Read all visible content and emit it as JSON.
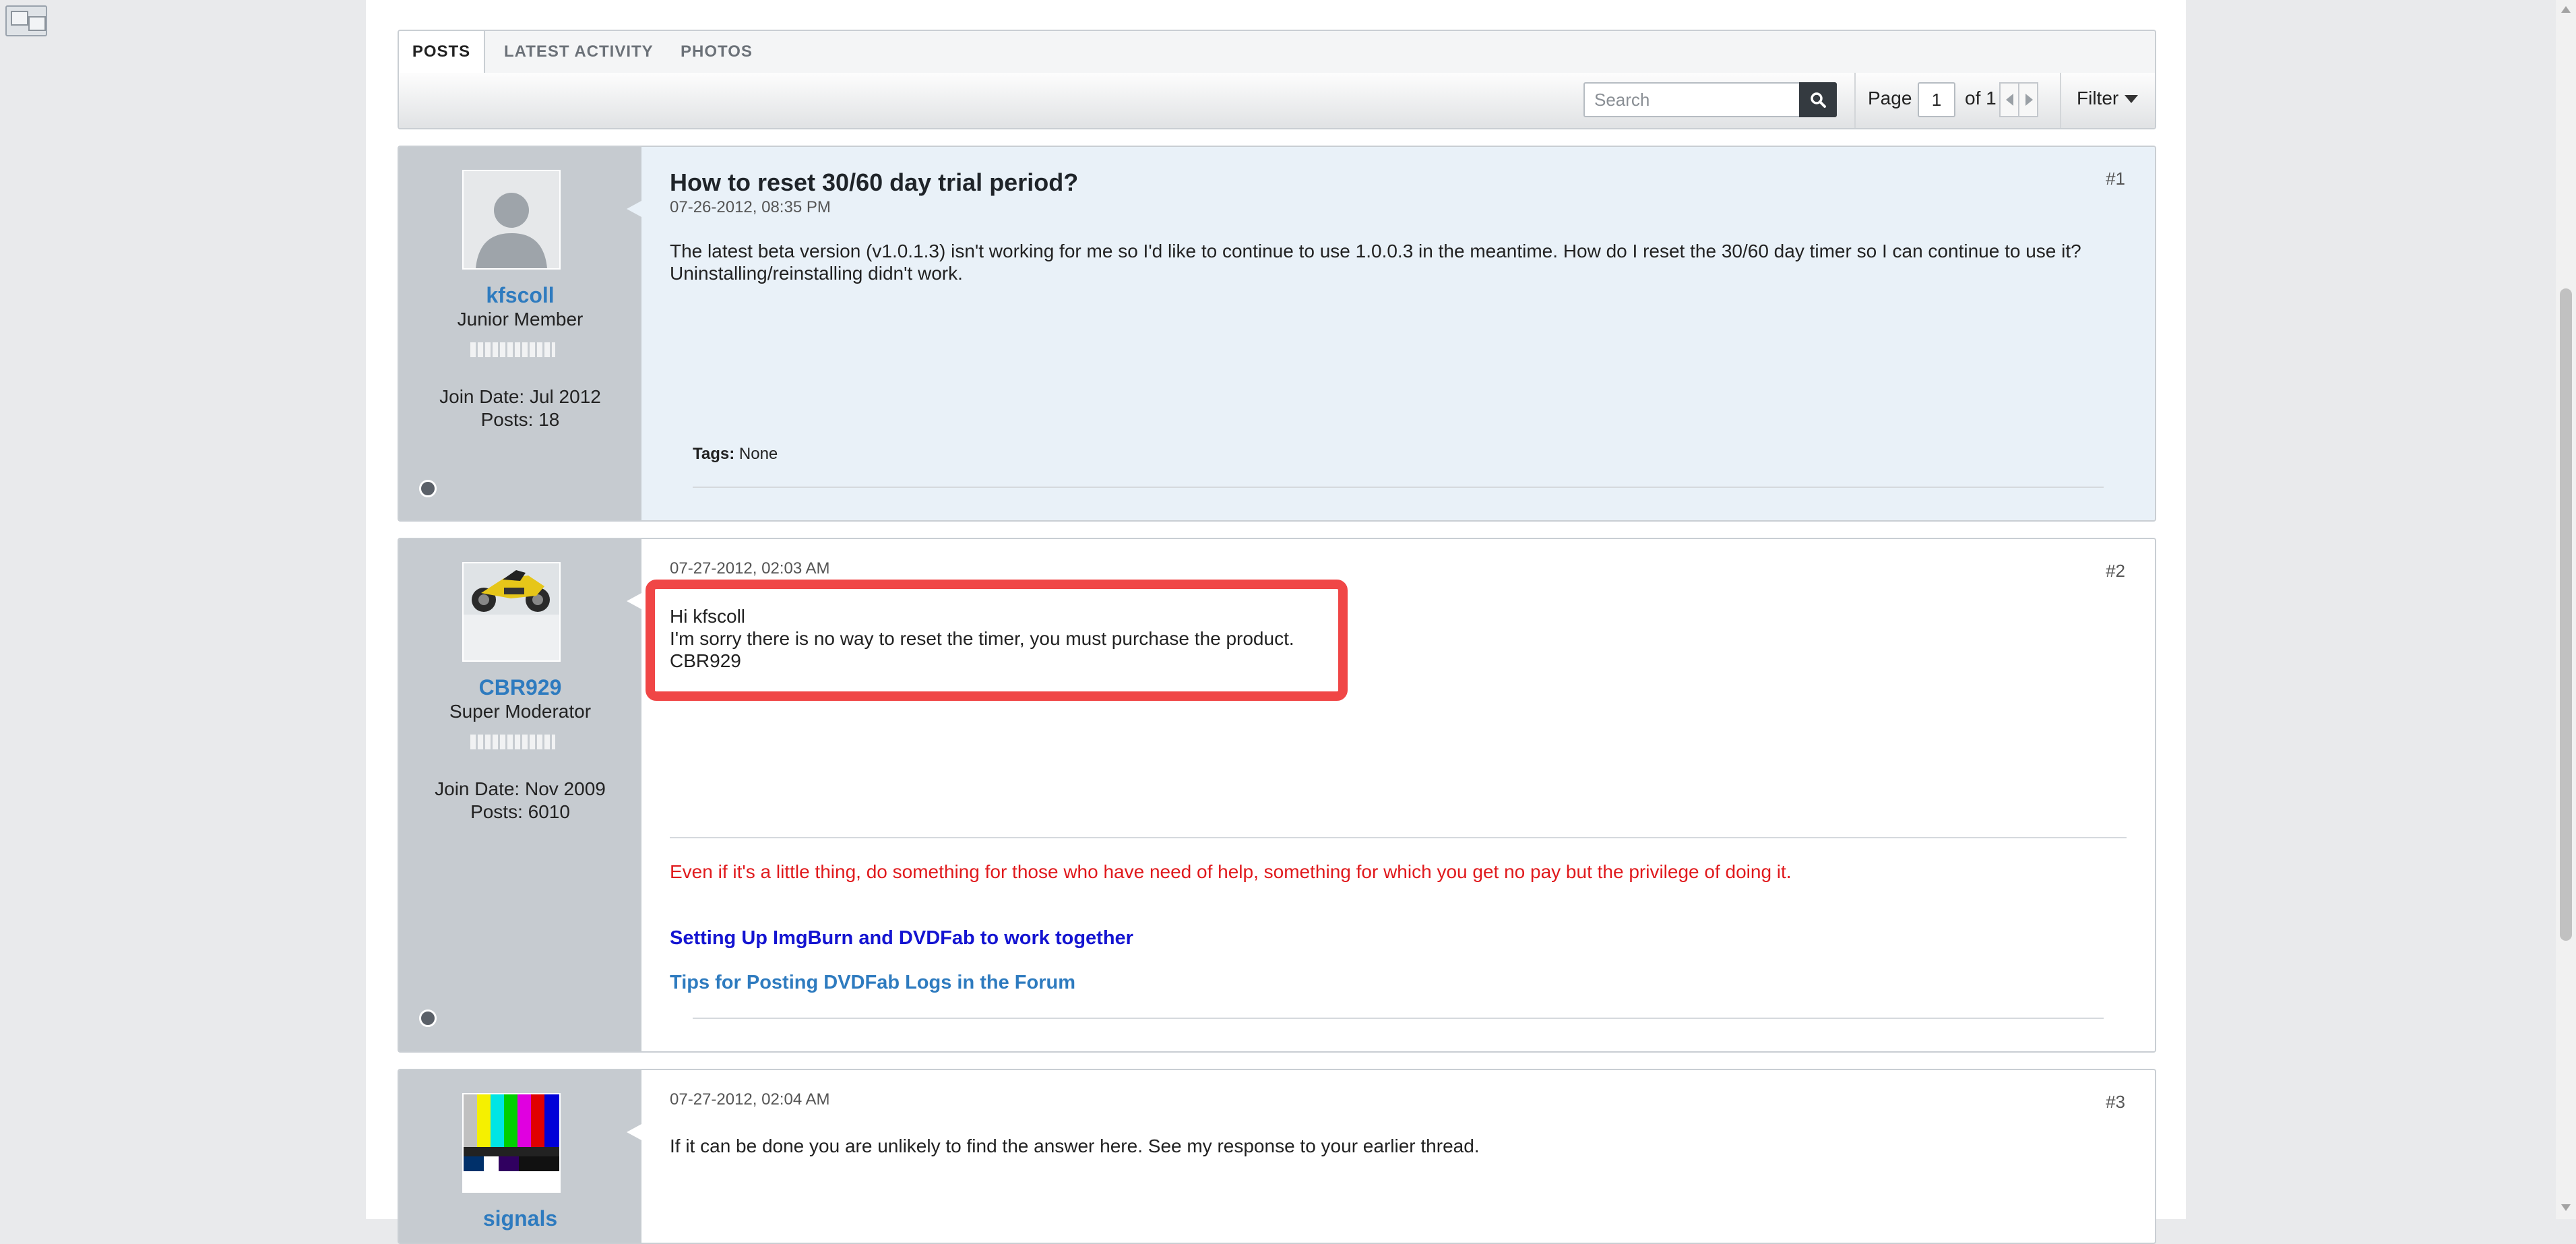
{
  "tabs": [
    {
      "label": "POSTS",
      "active": true
    },
    {
      "label": "LATEST ACTIVITY",
      "active": false
    },
    {
      "label": "PHOTOS",
      "active": false
    }
  ],
  "toolbar": {
    "search_placeholder": "Search",
    "page_label": "Page",
    "page_value": "1",
    "page_of": "of 1",
    "filter_label": "Filter"
  },
  "posts": [
    {
      "username": "kfscoll",
      "user_title": "Junior Member",
      "join_date": "Join Date: Jul 2012",
      "posts": "Posts: 18",
      "title": "How to reset 30/60 day trial period?",
      "date": "07-26-2012, 08:35 PM",
      "number": "#1",
      "text": "The latest beta version (v1.0.1.3) isn't working for me so I'd like to continue to use 1.0.0.3 in the meantime. How do I reset the 30/60 day timer so I can continue to use it? Uninstalling/reinstalling didn't work.",
      "tags_label": "Tags:",
      "tags_value": "None"
    },
    {
      "username": "CBR929",
      "user_title": "Super Moderator",
      "join_date": "Join Date: Nov 2009",
      "posts": "Posts: 6010",
      "date": "07-27-2012, 02:03 AM",
      "number": "#2",
      "text_lines": [
        "Hi kfscoll",
        "I'm sorry there is no way to reset the timer, you must purchase the product.",
        "CBR929"
      ],
      "signature_quote": "Even if it's a little thing, do something for those who have need of help, something for which you get no pay but the privilege of doing it.",
      "signature_link1": "Setting Up ImgBurn and DVDFab to work together",
      "signature_link2": "Tips for Posting DVDFab Logs in the Forum"
    },
    {
      "username": "signals",
      "date": "07-27-2012, 02:04 AM",
      "number": "#3",
      "text": "If it can be done you are unlikely to find the answer here. See my response to your earlier thread."
    }
  ],
  "colors": {
    "highlight": "#f04646",
    "username_link": "#2e7bbf",
    "signature_quote": "#e0191c",
    "signature_link1": "#1414d1"
  },
  "icons": [
    "image-icon",
    "search-icon",
    "prev-page-icon",
    "next-page-icon",
    "filter-caret-icon",
    "online-status-icon"
  ]
}
